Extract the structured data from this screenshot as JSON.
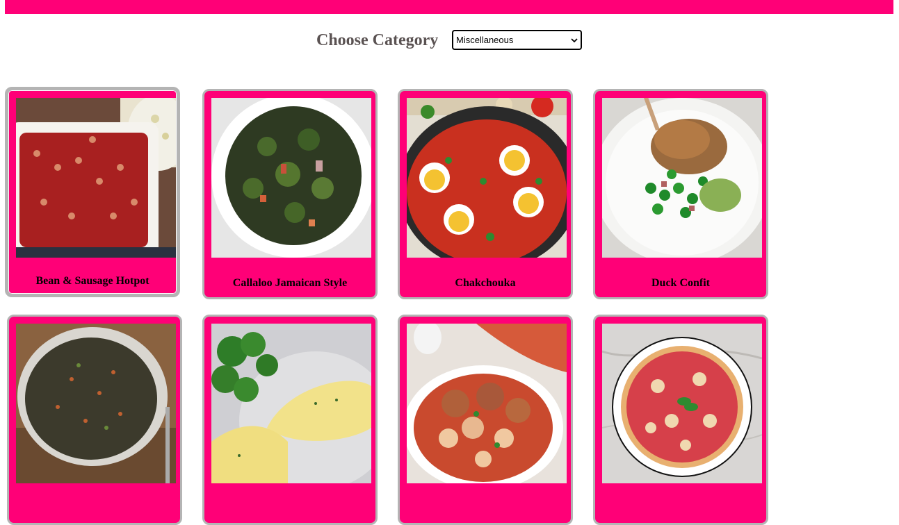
{
  "header": {
    "accent_color": "#ff0077"
  },
  "category": {
    "label": "Choose Category",
    "selected": "Miscellaneous"
  },
  "recipes": [
    {
      "name": "Bean & Sausage Hotpot",
      "image": "bean-sausage-hotpot-photo"
    },
    {
      "name": "Callaloo Jamaican Style",
      "image": "callaloo-photo"
    },
    {
      "name": "Chakchouka",
      "image": "chakchouka-photo"
    },
    {
      "name": "Duck Confit",
      "image": "duck-confit-photo"
    },
    {
      "name": "",
      "image": "lentil-bowl-photo"
    },
    {
      "name": "",
      "image": "omelette-photo"
    },
    {
      "name": "",
      "image": "meatball-pasta-photo"
    },
    {
      "name": "",
      "image": "pizza-photo"
    }
  ]
}
